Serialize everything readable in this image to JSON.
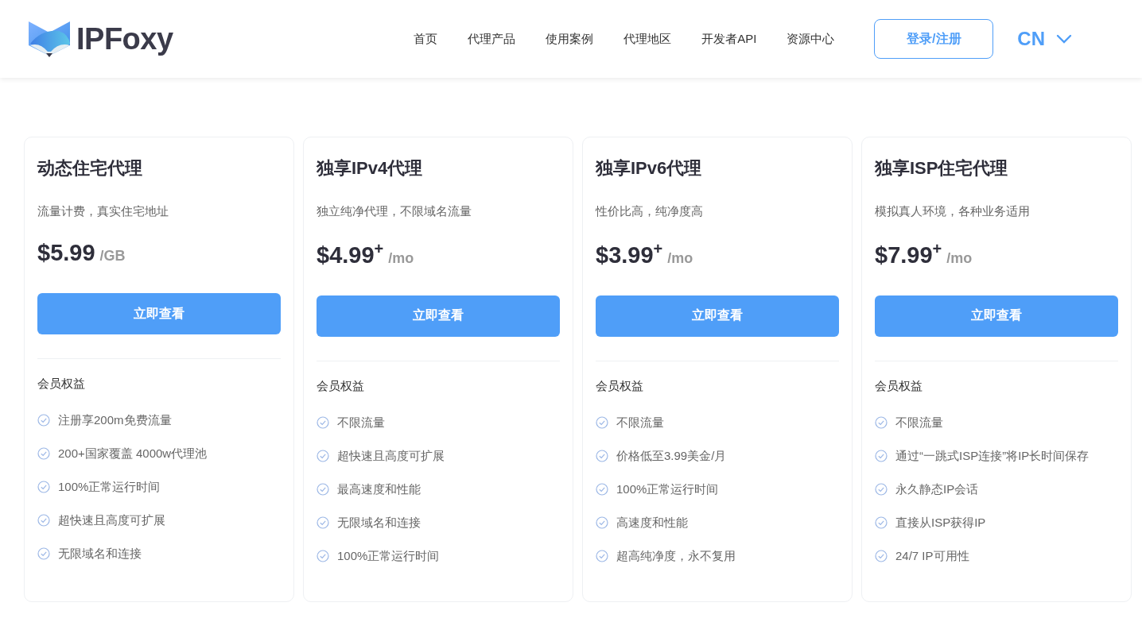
{
  "header": {
    "logo_text": "IPFoxy",
    "nav": [
      "首页",
      "代理产品",
      "使用案例",
      "代理地区",
      "开发者API",
      "资源中心"
    ],
    "login_button": "登录/注册",
    "language": "CN"
  },
  "plans": [
    {
      "title": "动态住宅代理",
      "description": "流量计费，真实住宅地址",
      "price": "$5.99",
      "unit": "/GB",
      "button": "立即查看",
      "benefits_label": "会员权益",
      "features": [
        "注册享200m免费流量",
        "200+国家覆盖 4000w代理池",
        "100%正常运行时间",
        "超快速且高度可扩展",
        "无限域名和连接"
      ]
    },
    {
      "title": "独享IPv4代理",
      "description": "独立纯净代理，不限域名流量",
      "price": "$4.99$^{+}$",
      "unit": "/mo",
      "button": "立即查看",
      "benefits_label": "会员权益",
      "features": [
        "不限流量",
        "超快速且高度可扩展",
        "最高速度和性能",
        "无限域名和连接",
        "100%正常运行时间"
      ]
    },
    {
      "title": "独享IPv6代理",
      "description": "性价比高，纯净度高",
      "price": "$3.99$^{+}$",
      "unit": "/mo",
      "button": "立即查看",
      "benefits_label": "会员权益",
      "features": [
        "不限流量",
        "价格低至3.99美金/月",
        "100%正常运行时间",
        "高速度和性能",
        "超高纯净度，永不复用"
      ]
    },
    {
      "title": "独享ISP住宅代理",
      "description": "模拟真人环境，各种业务适用",
      "price": "$7.99$^{+}$",
      "unit": "/mo",
      "button": "立即查看",
      "benefits_label": "会员权益",
      "features": [
        "不限流量",
        "通过“一跳式ISP连接”将IP长时间保存",
        "永久静态IP会话",
        "直接从ISP获得IP",
        "24/7 IP可用性"
      ]
    }
  ]
}
